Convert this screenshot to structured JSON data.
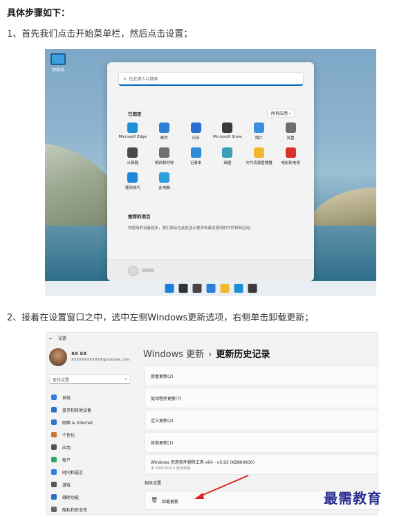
{
  "heading": "具体步骤如下：",
  "step1": "1、首先我们点击开始菜单栏，然后点击设置；",
  "step2": "2、接着在设置窗口之中，选中左侧Windows更新选项，右侧单击卸载更新；",
  "watermark": "最需教育",
  "shot1": {
    "desktop_icon_label": "回收站",
    "search_placeholder": "在此键入以搜索",
    "pinned_label": "已固定",
    "all_apps_label": "所有应用",
    "apps": [
      {
        "label": "Microsoft Edge",
        "color": "#1f8fd6",
        "icon": "edge-icon"
      },
      {
        "label": "邮件",
        "color": "#2f7fd8",
        "icon": "mail-icon"
      },
      {
        "label": "日历",
        "color": "#2a6fd0",
        "icon": "calendar-icon"
      },
      {
        "label": "Microsoft Store",
        "color": "#3b3b3b",
        "icon": "store-icon"
      },
      {
        "label": "照片",
        "color": "#3c8fe0",
        "icon": "photos-icon"
      },
      {
        "label": "设置",
        "color": "#6d6d6d",
        "icon": "settings-gear-icon"
      },
      {
        "label": "计算器",
        "color": "#4a4a4a",
        "icon": "calculator-icon"
      },
      {
        "label": "闹钟和时钟",
        "color": "#707070",
        "icon": "clock-icon"
      },
      {
        "label": "记事本",
        "color": "#2e8bd8",
        "icon": "notepad-icon"
      },
      {
        "label": "画图",
        "color": "#3aa0b8",
        "icon": "paint-icon"
      },
      {
        "label": "文件资源管理器",
        "color": "#f1b82d",
        "icon": "folder-icon"
      },
      {
        "label": "电影和电视",
        "color": "#d8322b",
        "icon": "movies-icon"
      },
      {
        "label": "使用技巧",
        "color": "#1e86d6",
        "icon": "tips-icon"
      },
      {
        "label": "此电脑",
        "color": "#2f9ee0",
        "icon": "this-pc-icon"
      }
    ],
    "recommended_title": "推荐的项目",
    "recommended_text": "你使用的设备越多，我们就会在此处显示更多你最近使用的文件和新应用。",
    "taskbar_icons": [
      {
        "name": "start-icon",
        "color": "#1e7fd8"
      },
      {
        "name": "search-icon",
        "color": "#333333"
      },
      {
        "name": "task-view-icon",
        "color": "#444444"
      },
      {
        "name": "widgets-icon",
        "color": "#2f7fd8"
      },
      {
        "name": "file-explorer-icon",
        "color": "#f1b82d"
      },
      {
        "name": "edge-icon",
        "color": "#1f8fd6"
      },
      {
        "name": "store-icon",
        "color": "#3b3b3b"
      }
    ]
  },
  "shot2": {
    "window_title": "设置",
    "user_name": "XX XX",
    "user_email": "XXXXXXXXXXXX@outlook.com",
    "search_placeholder": "查找设置",
    "nav": [
      {
        "label": "系统",
        "color": "#2f7fd8",
        "icon": "system-icon"
      },
      {
        "label": "蓝牙和其他设备",
        "color": "#2e6fc4",
        "icon": "bluetooth-icon"
      },
      {
        "label": "网络 & Internet",
        "color": "#2a77c9",
        "icon": "network-icon"
      },
      {
        "label": "个性化",
        "color": "#c9772a",
        "icon": "personalization-icon"
      },
      {
        "label": "应用",
        "color": "#555555",
        "icon": "apps-icon"
      },
      {
        "label": "帐户",
        "color": "#2fa36b",
        "icon": "accounts-icon"
      },
      {
        "label": "时间和语言",
        "color": "#2f7fd8",
        "icon": "time-language-icon"
      },
      {
        "label": "游戏",
        "color": "#555555",
        "icon": "gaming-icon"
      },
      {
        "label": "辅助功能",
        "color": "#2a6fc9",
        "icon": "accessibility-icon"
      },
      {
        "label": "隐私和安全性",
        "color": "#666666",
        "icon": "privacy-icon"
      }
    ],
    "breadcrumb_parent": "Windows 更新",
    "breadcrumb_sep": "›",
    "breadcrumb_current": "更新历史记录",
    "cards": [
      "质量更新(2)",
      "驱动程序更新(7)",
      "定义更新(2)",
      "其他更新(1)"
    ],
    "tool_update_title": "Windows 恶意软件删除工具 x64 - v5.93 (KB890830)",
    "tool_update_sub": "于 2021/10/12 成功安装",
    "related_label": "相关设置",
    "uninstall_label": "卸载更新"
  }
}
